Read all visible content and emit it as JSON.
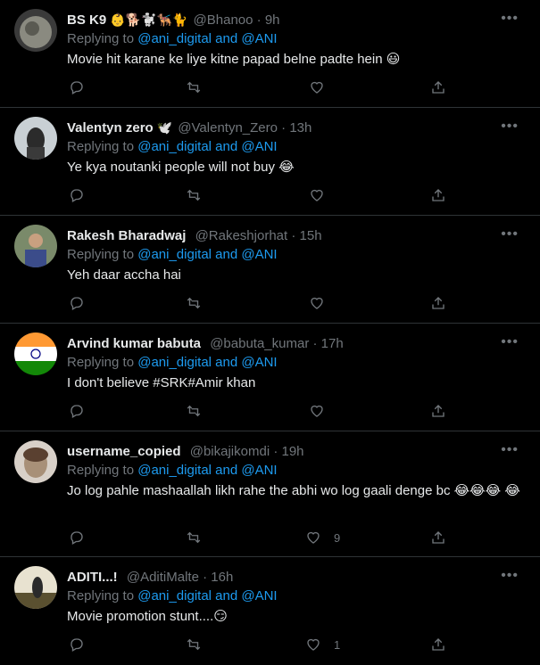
{
  "reply_prefix": "Replying to",
  "tweets": [
    {
      "name": "BS K9",
      "badges": "👶🐕🐩🐕‍🦺🐈",
      "handle": "@Bhanoo",
      "time": "9h",
      "reply_to": "@ani_digital and @ANI",
      "text": "Movie hit karane ke liye kitne papad belne padte hein 😃",
      "likes": "",
      "avatar_colors": [
        "#3a3a3a",
        "#8a8a80"
      ]
    },
    {
      "name": "Valentyn zero",
      "badges": "🕊️",
      "handle": "@Valentyn_Zero",
      "time": "13h",
      "reply_to": "@ani_digital and @ANI",
      "text": "Ye kya noutanki people will not buy 😂",
      "likes": "",
      "avatar_colors": [
        "#c9d0d4",
        "#2b2b2b"
      ]
    },
    {
      "name": "Rakesh Bharadwaj",
      "badges": "",
      "handle": "@Rakeshjorhat",
      "time": "15h",
      "reply_to": "@ani_digital and @ANI",
      "text": "Yeh daar accha hai",
      "likes": "",
      "avatar_colors": [
        "#7a8a6a",
        "#3b4c8a"
      ]
    },
    {
      "name": "Arvind kumar babuta",
      "badges": "",
      "handle": "@babuta_kumar",
      "time": "17h",
      "reply_to": "@ani_digital and @ANI",
      "text": "I don't believe #SRK#Amir khan",
      "likes": "",
      "avatar_colors": [
        "#ff9933",
        "#138808"
      ]
    },
    {
      "name": "username_copied",
      "badges": "",
      "handle": "@bikajikomdi",
      "time": "19h",
      "reply_to": "@ani_digital and @ANI",
      "text": "Jo log pahle mashaallah likh rahe the abhi wo log gaali denge bc 😂😂😂 😂",
      "likes": "9",
      "avatar_colors": [
        "#a89078",
        "#5a4030"
      ]
    },
    {
      "name": "ADITI...!",
      "badges": "",
      "handle": "@AditiMalte",
      "time": "16h",
      "reply_to": "@ani_digital and @ANI",
      "text": "Movie promotion stunt....😏",
      "likes": "1",
      "avatar_colors": [
        "#e8e2d0",
        "#5a5030"
      ]
    }
  ]
}
